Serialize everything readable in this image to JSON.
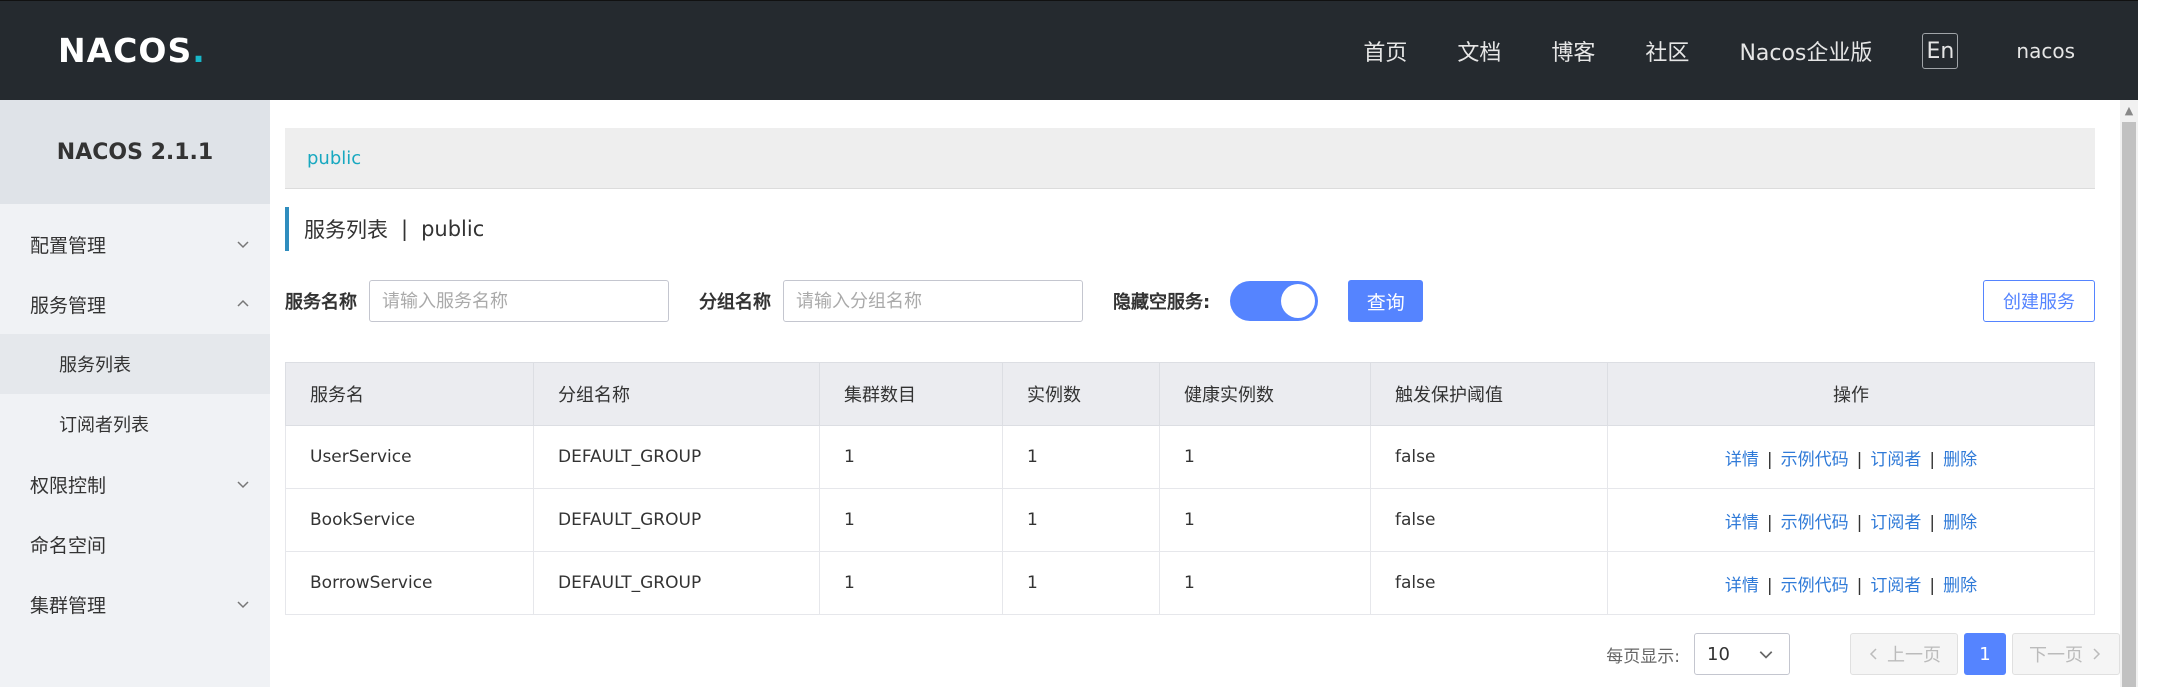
{
  "header": {
    "logo": {
      "n": "NA",
      "c": "C",
      "o": "O",
      "s": "S",
      "dot": "."
    },
    "nav": [
      "首页",
      "文档",
      "博客",
      "社区",
      "Nacos企业版"
    ],
    "lang": "En",
    "user": "nacos"
  },
  "sidebar": {
    "version": "NACOS 2.1.1",
    "items": [
      {
        "label": "配置管理"
      },
      {
        "label": "服务管理"
      },
      {
        "label": "服务列表"
      },
      {
        "label": "订阅者列表"
      },
      {
        "label": "权限控制"
      },
      {
        "label": "命名空间"
      },
      {
        "label": "集群管理"
      }
    ]
  },
  "namespace": {
    "current": "public"
  },
  "page": {
    "title": "服务列表",
    "sep": "|",
    "ns": "public"
  },
  "filters": {
    "service_label": "服务名称",
    "service_placeholder": "请输入服务名称",
    "group_label": "分组名称",
    "group_placeholder": "请输入分组名称",
    "hide_empty_label": "隐藏空服务:",
    "hide_empty_on": true,
    "query_label": "查询",
    "create_label": "创建服务"
  },
  "table": {
    "columns": [
      "服务名",
      "分组名称",
      "集群数目",
      "实例数",
      "健康实例数",
      "触发保护阈值",
      "操作"
    ],
    "rows": [
      [
        "UserService",
        "DEFAULT_GROUP",
        "1",
        "1",
        "1",
        "false"
      ],
      [
        "BookService",
        "DEFAULT_GROUP",
        "1",
        "1",
        "1",
        "false"
      ],
      [
        "BorrowService",
        "DEFAULT_GROUP",
        "1",
        "1",
        "1",
        "false"
      ]
    ],
    "actions": [
      "详情",
      "示例代码",
      "订阅者",
      "删除"
    ],
    "action_sep": "|"
  },
  "pagination": {
    "per_page_label": "每页显示:",
    "per_page": "10",
    "prev": "上一页",
    "current": "1",
    "next": "下一页"
  },
  "colors": {
    "accent": "#5584ff",
    "header_bg": "#252a2f",
    "link": "#2f7ad8",
    "ns_link": "#18a8c0"
  }
}
